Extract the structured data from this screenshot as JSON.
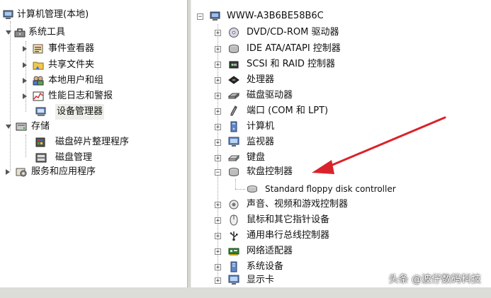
{
  "left_tree": {
    "root": "计算机管理(本地)",
    "system_tools": "系统工具",
    "event_viewer": "事件查看器",
    "shared_folders": "共享文件夹",
    "local_users": "本地用户和组",
    "perf_logs": "性能日志和警报",
    "device_manager": "设备管理器",
    "storage": "存储",
    "defrag": "磁盘碎片整理程序",
    "disk_mgmt": "磁盘管理",
    "services_apps": "服务和应用程序"
  },
  "right_tree": {
    "computer_name": "WWW-A3B6BE58B6C",
    "items": [
      "DVD/CD-ROM 驱动器",
      "IDE ATA/ATAPI 控制器",
      "SCSI 和 RAID 控制器",
      "处理器",
      "磁盘驱动器",
      "端口 (COM 和 LPT)",
      "计算机",
      "监视器",
      "键盘",
      "软盘控制器",
      "声音、视频和游戏控制器",
      "鼠标和其它指针设备",
      "通用串行总线控制器",
      "网络适配器",
      "系统设备",
      "显示卡"
    ],
    "floppy_child": "Standard floppy disk controller"
  },
  "annotation": {
    "arrow_color": "#d9232a"
  },
  "watermark": "头条 @波仔数码科技"
}
